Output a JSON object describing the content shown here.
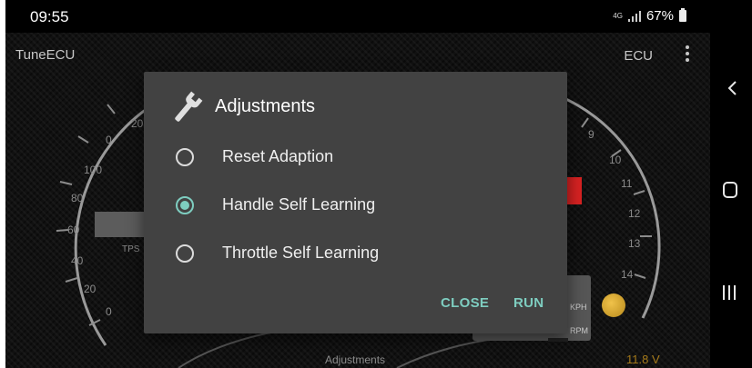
{
  "status": {
    "time": "09:55",
    "network": "4G",
    "battery": "67%",
    "icons": [
      "signal-icon",
      "battery-icon"
    ]
  },
  "app": {
    "title": "TuneECU",
    "ecu_label": "ECU",
    "menu_icon": "more-vertical-icon"
  },
  "gauges": {
    "left_ticks": [
      "20",
      "0",
      "100",
      "80",
      "60",
      "40",
      "20",
      "0"
    ],
    "left_label": "TPS",
    "right_ticks": [
      "9",
      "10",
      "11",
      "12",
      "13",
      "14"
    ],
    "bottom_label_1": "KPH",
    "bottom_label_2": "RPM"
  },
  "footer": {
    "label": "Adjustments",
    "voltage": "11.8 V"
  },
  "dialog": {
    "icon": "wrench-icon",
    "title": "Adjustments",
    "options": [
      {
        "label": "Reset Adaption",
        "checked": false
      },
      {
        "label": "Handle Self Learning",
        "checked": true
      },
      {
        "label": "Throttle Self Learning",
        "checked": false
      }
    ],
    "close_label": "CLOSE",
    "run_label": "RUN"
  },
  "colors": {
    "accent": "#7ecdc0",
    "dialog_bg": "#424242",
    "warning_red": "#d82222",
    "gold": "#d4a52e"
  },
  "navbar": {
    "icons": [
      "back-icon",
      "home-icon",
      "recent-apps-icon"
    ]
  }
}
